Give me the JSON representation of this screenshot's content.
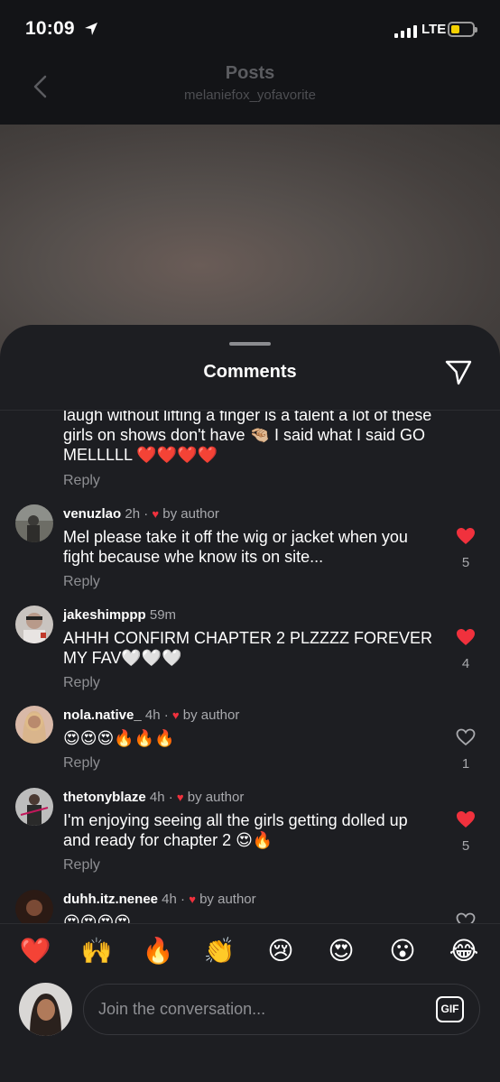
{
  "status_bar": {
    "time": "10:09",
    "network": "LTE"
  },
  "header": {
    "title": "Posts",
    "subtitle": "melaniefox_yofavorite"
  },
  "sheet": {
    "title": "Comments"
  },
  "partial_comment": {
    "text": "laugh without lifting a finger is a talent a lot of these girls on shows don't have 🤏🏼 I said what I said GO MELLLLL ❤️❤️❤️❤️",
    "reply_label": "Reply"
  },
  "comments": [
    {
      "username": "venuzlao",
      "time": "2h",
      "author_tag": "by author",
      "text": "Mel please take it off the wig or jacket when you fight because whe know its on site...",
      "reply_label": "Reply",
      "likes": "5",
      "liked": true
    },
    {
      "username": "jakeshimppp",
      "time": "59m",
      "author_tag": "",
      "text": "AHHH CONFIRM CHAPTER 2 PLZZZZ FOREVER MY FAV🤍🤍🤍",
      "reply_label": "Reply",
      "likes": "4",
      "liked": true
    },
    {
      "username": "nola.native_",
      "time": "4h",
      "author_tag": "by author",
      "text": "😍😍😍🔥🔥🔥",
      "reply_label": "Reply",
      "likes": "1",
      "liked": false
    },
    {
      "username": "thetonyblaze",
      "time": "4h",
      "author_tag": "by author",
      "text": "I'm enjoying seeing all the girls getting dolled up and ready for chapter 2 😍🔥",
      "reply_label": "Reply",
      "likes": "5",
      "liked": true
    },
    {
      "username": "duhh.itz.nenee",
      "time": "4h",
      "author_tag": "by author",
      "text": "😍😍😍😍",
      "reply_label": "",
      "likes": "",
      "liked": false
    }
  ],
  "quick_emojis": [
    "❤️",
    "🙌",
    "🔥",
    "👏",
    "😢",
    "😍",
    "😮",
    "😂"
  ],
  "composer": {
    "placeholder": "Join the conversation...",
    "gif_label": "GIF"
  },
  "colors": {
    "like_red": "#f0313d",
    "sheet_bg": "#1d1e22",
    "muted_text": "#8e8f93"
  }
}
